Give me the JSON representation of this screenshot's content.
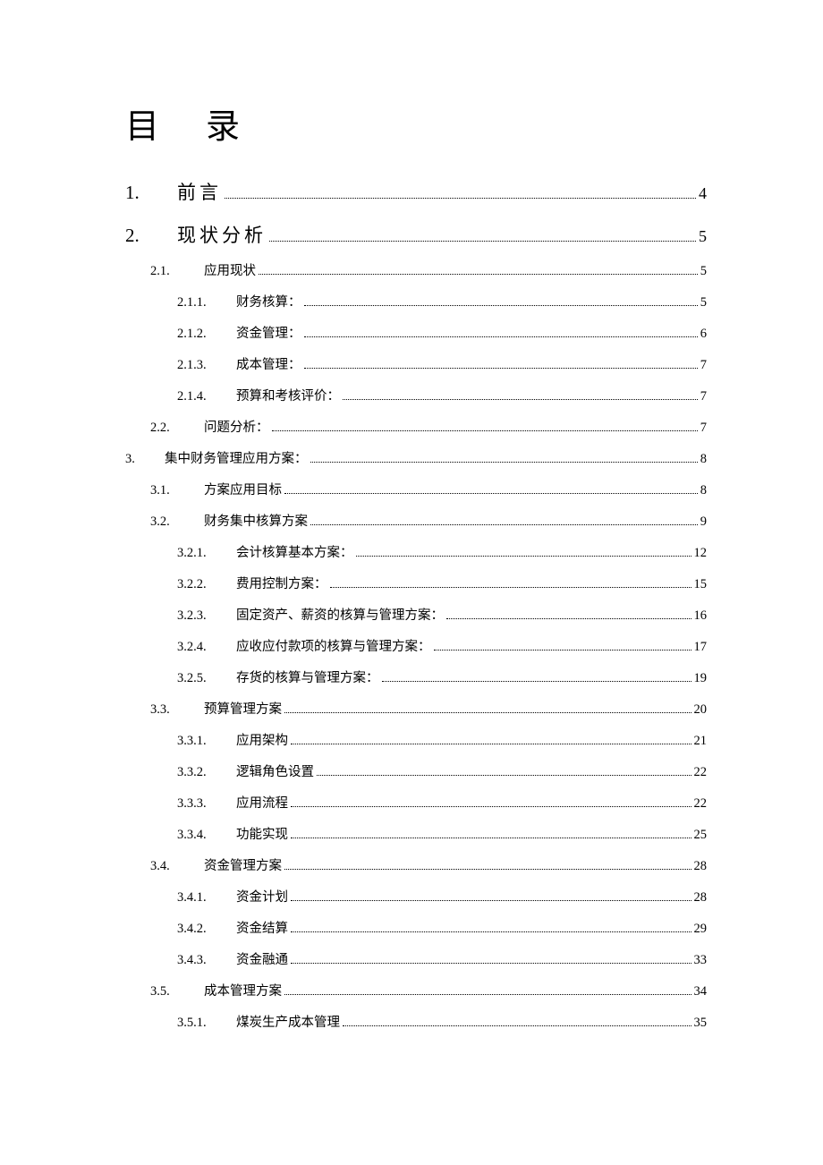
{
  "title": "目录",
  "toc": [
    {
      "level": 1,
      "num": "1.",
      "label": "前言",
      "page": "4",
      "big": true
    },
    {
      "level": 1,
      "num": "2.",
      "label": "现状分析",
      "page": "5",
      "big": true
    },
    {
      "level": 2,
      "num": "2.1.",
      "label": "应用现状",
      "page": "5"
    },
    {
      "level": 3,
      "num": "2.1.1.",
      "label": "财务核算：",
      "page": "5"
    },
    {
      "level": 3,
      "num": "2.1.2.",
      "label": "资金管理：",
      "page": "6"
    },
    {
      "level": 3,
      "num": "2.1.3.",
      "label": "成本管理：",
      "page": "7"
    },
    {
      "level": 3,
      "num": "2.1.4.",
      "label": "预算和考核评价：",
      "page": "7"
    },
    {
      "level": 2,
      "num": "2.2.",
      "label": "问题分析：",
      "page": "7"
    },
    {
      "level": 1,
      "num": "3.",
      "label": "集中财务管理应用方案：",
      "page": "8",
      "big": false
    },
    {
      "level": 2,
      "num": "3.1.",
      "label": "方案应用目标",
      "page": "8"
    },
    {
      "level": 2,
      "num": "3.2.",
      "label": "财务集中核算方案",
      "page": "9"
    },
    {
      "level": 3,
      "num": "3.2.1.",
      "label": "会计核算基本方案：",
      "page": "12"
    },
    {
      "level": 3,
      "num": "3.2.2.",
      "label": "费用控制方案：",
      "page": "15"
    },
    {
      "level": 3,
      "num": "3.2.3.",
      "label": "固定资产、薪资的核算与管理方案：",
      "page": "16"
    },
    {
      "level": 3,
      "num": "3.2.4.",
      "label": "应收应付款项的核算与管理方案：",
      "page": "17"
    },
    {
      "level": 3,
      "num": "3.2.5.",
      "label": "存货的核算与管理方案：",
      "page": "19"
    },
    {
      "level": 2,
      "num": "3.3.",
      "label": "预算管理方案",
      "page": "20"
    },
    {
      "level": 3,
      "num": "3.3.1.",
      "label": "应用架构",
      "page": "21"
    },
    {
      "level": 3,
      "num": "3.3.2.",
      "label": "逻辑角色设置",
      "page": "22"
    },
    {
      "level": 3,
      "num": "3.3.3.",
      "label": "应用流程",
      "page": "22"
    },
    {
      "level": 3,
      "num": "3.3.4.",
      "label": "功能实现",
      "page": "25"
    },
    {
      "level": 2,
      "num": "3.4.",
      "label": "资金管理方案",
      "page": "28"
    },
    {
      "level": 3,
      "num": "3.4.1.",
      "label": "资金计划",
      "page": "28"
    },
    {
      "level": 3,
      "num": "3.4.2.",
      "label": "资金结算",
      "page": "29"
    },
    {
      "level": 3,
      "num": "3.4.3.",
      "label": "资金融通",
      "page": "33"
    },
    {
      "level": 2,
      "num": "3.5.",
      "label": "成本管理方案",
      "page": "34"
    },
    {
      "level": 3,
      "num": "3.5.1.",
      "label": "煤炭生产成本管理",
      "page": "35"
    }
  ]
}
